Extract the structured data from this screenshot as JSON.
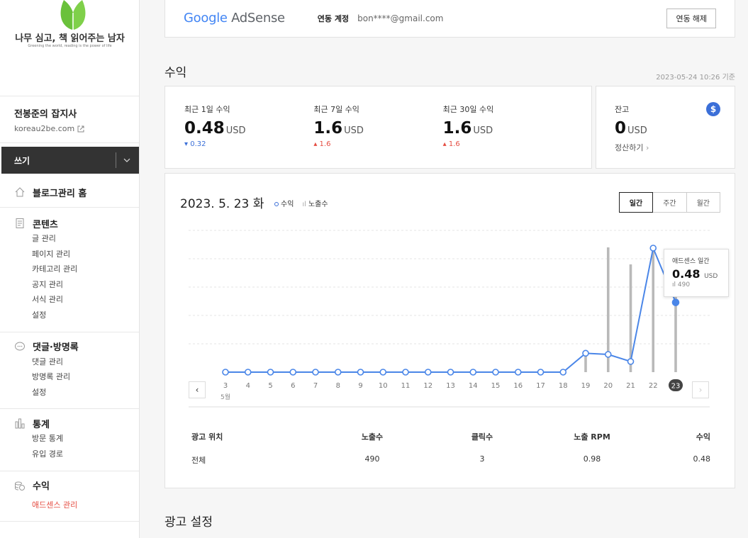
{
  "sidebar": {
    "logo_title": "나무 심고, 책 읽어주는 남자",
    "logo_sub": "Greening the world, reading is the power of life",
    "blog_name": "전봉준의 잡지사",
    "blog_url": "koreau2be.com",
    "write_label": "쓰기",
    "groups": [
      {
        "label": "블로그관리 홈",
        "icon": "home-icon",
        "items": []
      },
      {
        "label": "콘텐츠",
        "icon": "document-icon",
        "items": [
          "글 관리",
          "페이지 관리",
          "카테고리 관리",
          "공지 관리",
          "서식 관리",
          "설정"
        ]
      },
      {
        "label": "댓글·방명록",
        "icon": "comment-icon",
        "items": [
          "댓글 관리",
          "방명록 관리",
          "설정"
        ]
      },
      {
        "label": "통계",
        "icon": "bar-chart-icon",
        "items": [
          "방문 통계",
          "유입 경로"
        ]
      },
      {
        "label": "수익",
        "icon": "coins-icon",
        "items": [
          "애드센스 관리"
        ]
      }
    ]
  },
  "adsense": {
    "brand_google": "Google",
    "brand_adsense": "AdSense",
    "linked_label": "연동 계정",
    "email": "bon****@gmail.com",
    "unlink_label": "연동 해제"
  },
  "revenue": {
    "section_title": "수익",
    "updated": "2023-05-24 10:26 기준",
    "items": [
      {
        "label": "최근 1일 수익",
        "value": "0.48",
        "unit": "USD",
        "delta": "0.32",
        "direction": "down"
      },
      {
        "label": "최근 7일 수익",
        "value": "1.6",
        "unit": "USD",
        "delta": "1.6",
        "direction": "up"
      },
      {
        "label": "최근 30일 수익",
        "value": "1.6",
        "unit": "USD",
        "delta": "1.6",
        "direction": "up"
      }
    ],
    "balance": {
      "label": "잔고",
      "value": "0",
      "unit": "USD",
      "action": "정산하기"
    }
  },
  "chart": {
    "date": "2023. 5. 23 화",
    "legend_revenue": "수익",
    "legend_impressions": "노출수",
    "tabs": [
      "일간",
      "주간",
      "월간"
    ],
    "active_tab": "일간",
    "month_label": "5월",
    "tooltip": {
      "title": "애드센스 일간",
      "value": "0.48",
      "unit": "USD",
      "impressions": "490"
    }
  },
  "chart_data": {
    "type": "line",
    "x": [
      "3",
      "4",
      "5",
      "6",
      "7",
      "8",
      "9",
      "10",
      "11",
      "12",
      "13",
      "14",
      "15",
      "16",
      "17",
      "18",
      "19",
      "20",
      "21",
      "22",
      "23"
    ],
    "series": [
      {
        "name": "수익",
        "values": [
          0,
          0,
          0,
          0,
          0,
          0,
          0,
          0,
          0,
          0,
          0,
          0,
          0,
          0,
          0,
          0,
          0.16,
          0.15,
          0.09,
          1.05,
          0.59
        ]
      },
      {
        "name": "노출수",
        "values": [
          0,
          0,
          0,
          0,
          0,
          0,
          0,
          0,
          0,
          0,
          0,
          0,
          0,
          0,
          0,
          0,
          140,
          880,
          760,
          880,
          750
        ]
      }
    ],
    "selected": "23"
  },
  "table": {
    "headers": [
      "광고 위치",
      "노출수",
      "클릭수",
      "노출 RPM",
      "수익"
    ],
    "rows": [
      [
        "전체",
        "490",
        "3",
        "0.98",
        "0.48"
      ]
    ]
  },
  "ad_settings_title": "광고 설정",
  "colors": {
    "accent": "#3b6fd8",
    "up": "#e54d42",
    "line": "#4a86e8",
    "bar": "#b9b9b9"
  }
}
